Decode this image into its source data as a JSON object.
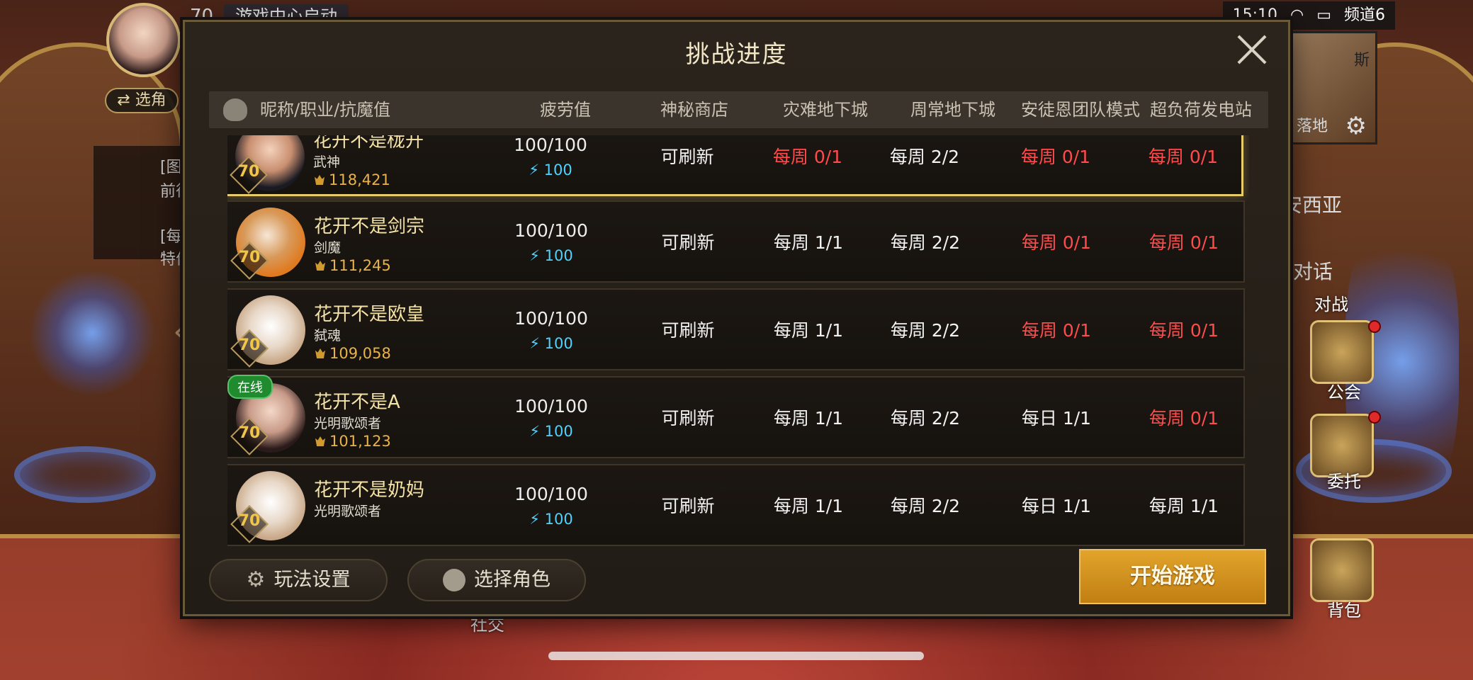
{
  "hud": {
    "level": "70",
    "launch_chip": "游戏中心启动",
    "switch_role": "⇄ 选角",
    "quest_lines": [
      "[图",
      "前往",
      "[每",
      "特价"
    ],
    "time": "15:10",
    "channel": "频道6",
    "minimap_label": "斯",
    "minimap_bottom": "落地",
    "npc_name": "安西亚",
    "npc_talk": "对话",
    "side_menu": [
      {
        "label": "对战",
        "icon": "battle-icon"
      },
      {
        "label": "公会",
        "icon": "guild-icon"
      },
      {
        "label": "委托",
        "icon": "commission-icon"
      },
      {
        "label": "背包",
        "icon": "backpack-icon"
      }
    ],
    "social_label": "社交"
  },
  "modal": {
    "title": "挑战进度",
    "columns": [
      "昵称/职业/抗魔值",
      "疲劳值",
      "神秘商店",
      "灾难地下城",
      "周常地下城",
      "安徒恩团队模式",
      "超负荷发电站"
    ],
    "rows": [
      {
        "name": "花开不是栊开",
        "job": "武神",
        "power": "118,421",
        "level": "70",
        "online": false,
        "fatigue": "100/100",
        "fatigue_sub": "100",
        "shop": "可刷新",
        "disaster": "每周 0/1",
        "weekly": "每周 2/2",
        "anton": "每周 0/1",
        "overload": "每周 0/1",
        "colors": [
          "white",
          "red",
          "white",
          "red",
          "red"
        ]
      },
      {
        "name": "花开不是剑宗",
        "job": "剑魔",
        "power": "111,245",
        "level": "70",
        "online": false,
        "fatigue": "100/100",
        "fatigue_sub": "100",
        "shop": "可刷新",
        "disaster": "每周 1/1",
        "weekly": "每周 2/2",
        "anton": "每周 0/1",
        "overload": "每周 0/1",
        "colors": [
          "white",
          "white",
          "white",
          "red",
          "red"
        ]
      },
      {
        "name": "花开不是欧皇",
        "job": "弑魂",
        "power": "109,058",
        "level": "70",
        "online": false,
        "fatigue": "100/100",
        "fatigue_sub": "100",
        "shop": "可刷新",
        "disaster": "每周 1/1",
        "weekly": "每周 2/2",
        "anton": "每周 0/1",
        "overload": "每周 0/1",
        "colors": [
          "white",
          "white",
          "white",
          "red",
          "red"
        ]
      },
      {
        "name": "花开不是A",
        "job": "光明歌颂者",
        "power": "101,123",
        "level": "70",
        "online": true,
        "online_label": "在线",
        "fatigue": "100/100",
        "fatigue_sub": "100",
        "shop": "可刷新",
        "disaster": "每周 1/1",
        "weekly": "每周 2/2",
        "anton": "每日 1/1",
        "overload": "每周 0/1",
        "colors": [
          "white",
          "white",
          "white",
          "white",
          "red"
        ]
      },
      {
        "name": "花开不是奶妈",
        "job": "光明歌颂者",
        "power": "",
        "level": "70",
        "online": false,
        "fatigue": "100/100",
        "fatigue_sub": "100",
        "shop": "可刷新",
        "disaster": "每周 1/1",
        "weekly": "每周 2/2",
        "anton": "每日 1/1",
        "overload": "每周 1/1",
        "colors": [
          "white",
          "white",
          "white",
          "white",
          "white"
        ]
      }
    ],
    "footer": {
      "settings_label": "玩法设置",
      "select_role_label": "选择角色",
      "start_label": "开始游戏"
    }
  },
  "colors": {
    "red": "#ff4b4b",
    "white": "#f2f2f2",
    "gold": "#c88a1a",
    "selected_border": "#e8cc6a",
    "fatigue_blue": "#4ed2ff"
  }
}
